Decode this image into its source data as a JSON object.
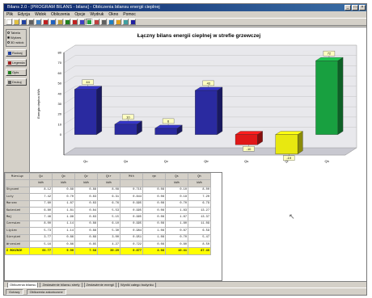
{
  "window": {
    "title": "Bilans 2.0 - [PROGRAM BILANS - bilans] - Obliczenia bilansu energii cieplnej",
    "buttons": [
      "_",
      "□",
      "×"
    ]
  },
  "menu": [
    "Plik",
    "Edycja",
    "Widok",
    "Obliczenia",
    "Opcje",
    "Wydruk",
    "Okno",
    "Pomoc"
  ],
  "toolbar": {
    "icons": [
      {
        "name": "new-icon",
        "color": "#ffffff"
      },
      {
        "name": "open-icon",
        "color": "#e0c040"
      },
      {
        "name": "save-icon",
        "color": "#2040a0"
      },
      {
        "name": "print-icon",
        "color": "#606060"
      },
      {
        "name": "preview-icon",
        "color": "#4080c0"
      },
      {
        "name": "cut-icon",
        "color": "#c02020"
      },
      {
        "name": "copy-icon",
        "color": "#2060c0"
      },
      {
        "name": "paste-icon",
        "color": "#c0a030"
      },
      {
        "name": "undo-icon",
        "color": "#208020"
      },
      {
        "name": "calculate-icon",
        "color": "#c02020"
      },
      {
        "name": "table-icon",
        "color": "#4040c0"
      },
      {
        "name": "chart-icon",
        "color": "#20a040"
      },
      {
        "name": "chart-3d-icon",
        "color": "#c04040"
      },
      {
        "name": "settings-icon",
        "color": "#606060"
      },
      {
        "name": "zoom-icon",
        "color": "#2080c0"
      },
      {
        "name": "color-icon",
        "color": "#e0a020"
      },
      {
        "name": "grid-icon",
        "color": "#40a0a0"
      },
      {
        "name": "help-icon",
        "color": "#2020a0"
      }
    ]
  },
  "left_panel": {
    "radios": [
      {
        "label": "Tabela",
        "checked": false
      },
      {
        "label": "Wykres",
        "checked": true
      },
      {
        "label": "3D widok",
        "checked": false
      }
    ],
    "buttons": [
      {
        "label": "Rodzaj",
        "icon": "chart-type-icon",
        "color": "#2040a0"
      },
      {
        "label": "Legenda",
        "icon": "legend-icon",
        "color": "#a02020"
      },
      {
        "label": "Opis",
        "icon": "labels-icon",
        "color": "#208020"
      },
      {
        "label": "Drukuj",
        "icon": "print-icon",
        "color": "#606060"
      }
    ]
  },
  "chart_data": {
    "type": "bar",
    "title": "Łączny bilans energii cieplnej w strefie grzewczej",
    "ylabel": "Energia cieplna kWh",
    "ylim": [
      0,
      80
    ],
    "yticks": [
      0,
      10,
      20,
      30,
      40,
      50,
      60,
      70,
      80
    ],
    "categories": [
      "Qu",
      "Qo",
      "Qv",
      "Qtr",
      "Qs",
      "Qi",
      "Qh"
    ],
    "values": [
      44,
      10,
      6,
      43,
      -10,
      -19,
      72
    ],
    "colors": [
      "#2a2aa0",
      "#2a2aa0",
      "#2a2aa0",
      "#2a2aa0",
      "#e01818",
      "#e8e810",
      "#18a040"
    ],
    "data_labels": [
      "44",
      "10",
      "6",
      "43",
      "-10",
      "-19",
      "72"
    ]
  },
  "grid": {
    "headers": [
      "Miesiąc",
      "Qu",
      "Qo",
      "Qv",
      "Qtr",
      "Mth",
      "ηm",
      "Qs",
      "Qh"
    ],
    "units": [
      "",
      "kWh",
      "kWh",
      "kWh",
      "kWh",
      "",
      "",
      "kWh",
      "kWh"
    ],
    "rows": [
      [
        "Styczeń",
        "8.12",
        "0.88",
        "0.88",
        "8.08",
        "0.715",
        "0.08",
        "0.10",
        "8.00"
      ],
      [
        "Luty",
        "7.42",
        "0.70",
        "0.83",
        "6.31",
        "0.844",
        "0.08",
        "0.18",
        "7.20"
      ],
      [
        "Marzec",
        "7.60",
        "1.87",
        "0.83",
        "6.76",
        "0.995",
        "0.08",
        "0.70",
        "6.79"
      ],
      [
        "Kwiecień",
        "6.80",
        "1.81",
        "0.84",
        "5.53",
        "0.995",
        "0.08",
        "1.83",
        "13.27"
      ],
      [
        "Maj",
        "7.46",
        "1.98",
        "0.83",
        "5.15",
        "0.995",
        "0.08",
        "1.87",
        "13.37"
      ],
      [
        "Czerwiec",
        "8.00",
        "1.14",
        "0.88",
        "6.10",
        "0.995",
        "0.08",
        "1.80",
        "11.09"
      ],
      [
        "Lipiec",
        "5.73",
        "1.14",
        "0.88",
        "5.30",
        "0.984",
        "1.08",
        "0.87",
        "6.59"
      ],
      [
        "Sierpień",
        "3.77",
        "0.86",
        "0.89",
        "3.00",
        "0.951",
        "1.08",
        "0.70",
        "5.47"
      ],
      [
        "Wrzesień",
        "5.16",
        "0.86",
        "0.85",
        "4.27",
        "0.722",
        "0.08",
        "0.80",
        "8.50"
      ]
    ],
    "sum_row": [
      "Σ ROCZNIE",
      "66.77",
      "9.90",
      "7.68",
      "39.29",
      "0.877",
      "4.08",
      "10.41",
      "87.46"
    ]
  },
  "tabs": [
    "Obliczenia bilansu",
    "Zestawienie bilansu strefy",
    "Zestawienie energii",
    "Wyniki całego budynku"
  ],
  "status": [
    "Gotowy",
    "Obliczenia zakończone"
  ]
}
